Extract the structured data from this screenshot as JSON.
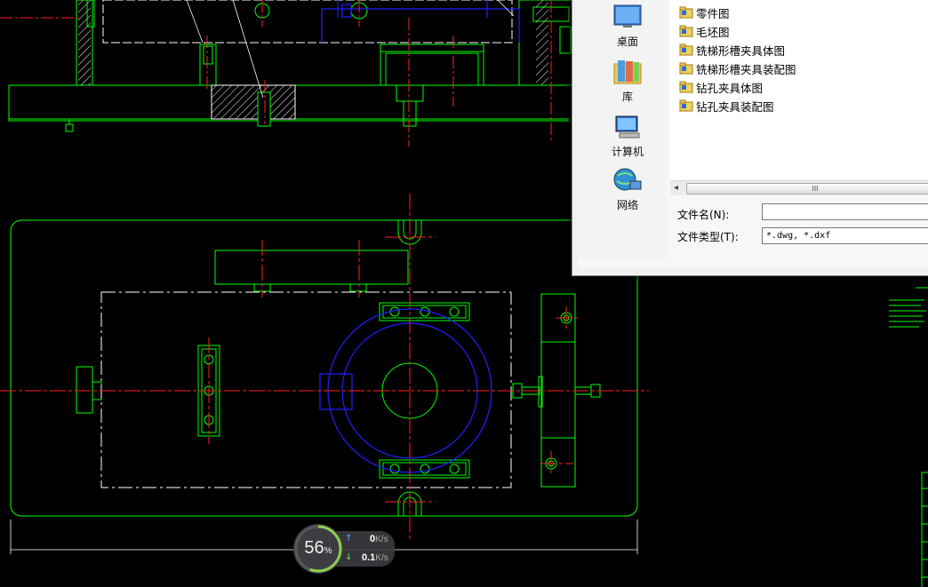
{
  "colors": {
    "background": "#000000",
    "outline": "#00ff00",
    "centerline": "#ff2020",
    "hidden": "#2020ff",
    "dim": "#ffffff"
  },
  "dialog": {
    "places": [
      {
        "label": "桌面",
        "icon": "desktop-icon"
      },
      {
        "label": "库",
        "icon": "library-icon"
      },
      {
        "label": "计算机",
        "icon": "computer-icon"
      },
      {
        "label": "网络",
        "icon": "network-icon"
      }
    ],
    "files": [
      {
        "name": "零件图"
      },
      {
        "name": "毛坯图"
      },
      {
        "name": "铣梯形槽夹具体图"
      },
      {
        "name": "铣梯形槽夹具装配图"
      },
      {
        "name": "钻孔夹具体图"
      },
      {
        "name": "钻孔夹具装配图"
      }
    ],
    "scrollbar_thumb": "III",
    "filename_label": "文件名(N):",
    "filename_value": "",
    "filetype_label": "文件类型(T):",
    "filetype_value": "*.dwg, *.dxf"
  },
  "net_widget": {
    "percent": "56",
    "percent_sign": "%",
    "upload_value": "0",
    "upload_unit": "K/s",
    "download_value": "0.1",
    "download_unit": "K/s",
    "gauge_fraction": 0.56
  }
}
